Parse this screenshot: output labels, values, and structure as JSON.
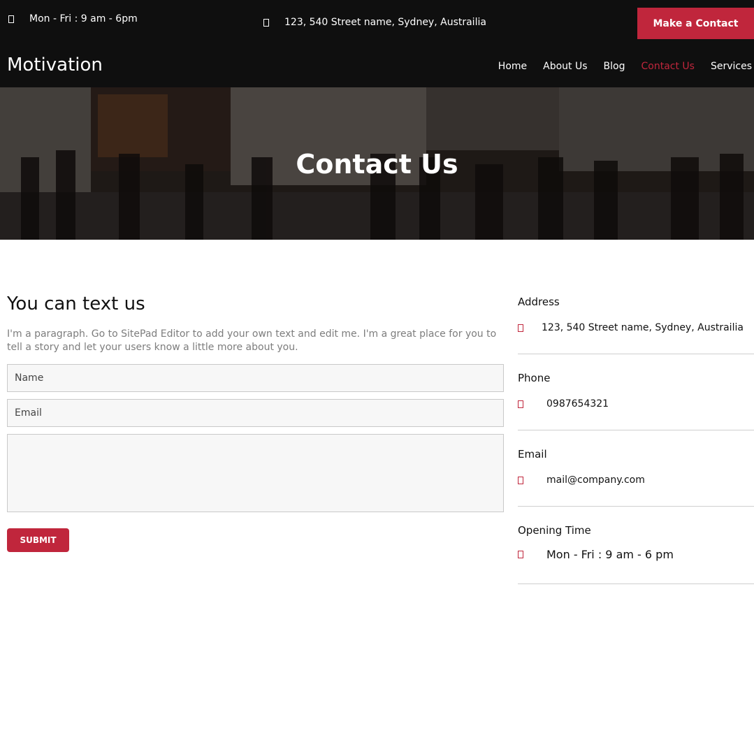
{
  "topbar": {
    "hours": "Mon - Fri : 9 am - 6pm",
    "address": "123, 540 Street name, Sydney, Austrailia",
    "cta_label": "Make a Contact"
  },
  "brand": "Motivation",
  "nav": {
    "home": "Home",
    "about": "About Us",
    "blog": "Blog",
    "contact": "Contact Us",
    "services": "Services"
  },
  "hero": {
    "title": "Contact Us"
  },
  "form": {
    "title": "You can text us",
    "paragraph": "I'm a paragraph. Go to SitePad Editor to add your own text and edit me. I'm a great place for you to tell a story and let your users know a little more about you.",
    "name_placeholder": "Name",
    "email_placeholder": "Email",
    "submit_label": "SUBMIT"
  },
  "contact_info": {
    "address": {
      "label": "Address",
      "value": "123, 540 Street name, Sydney, Austrailia"
    },
    "phone": {
      "label": "Phone",
      "value": "0987654321"
    },
    "email": {
      "label": "Email",
      "value": "mail@company.com"
    },
    "hours": {
      "label": "Opening Time",
      "value": "Mon - Fri : 9 am - 6 pm"
    }
  },
  "colors": {
    "accent": "#c0263c",
    "header_bg": "#0f0f0f",
    "input_bg": "#f7f7f7"
  }
}
